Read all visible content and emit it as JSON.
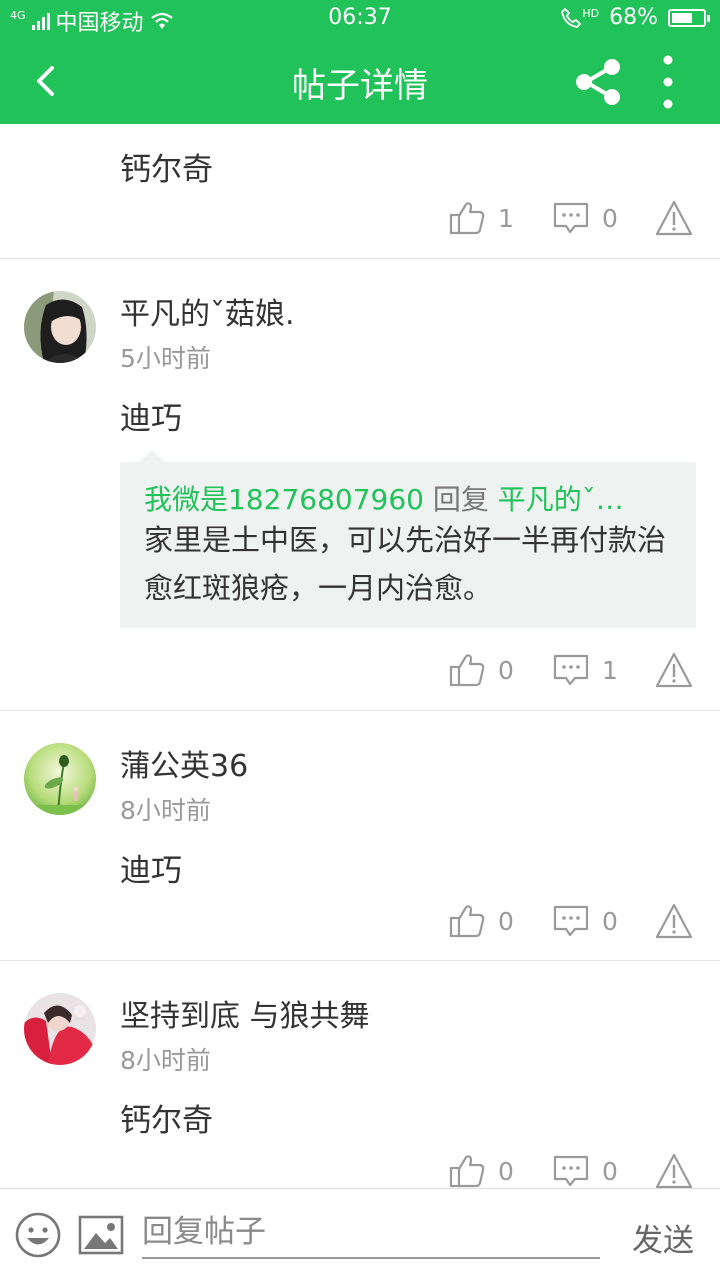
{
  "status_bar": {
    "network": "4G",
    "carrier": "中国移动",
    "time": "06:37",
    "call_icon": "phone-hd-icon",
    "hd_label": "HD",
    "battery_percent": "68%",
    "battery_level": 0.68
  },
  "header": {
    "title": "帖子详情",
    "back_icon": "chevron-left-icon",
    "share_icon": "share-icon",
    "more_icon": "more-vertical-icon",
    "color": "#22c25a"
  },
  "posts": [
    {
      "text": "钙尔奇",
      "likes": "1",
      "comments": "0"
    },
    {
      "username": "平凡的ˇ菇娘.",
      "time": "5小时前",
      "text": "迪巧",
      "reply": {
        "author": "我微是18276807960",
        "verb": "回复",
        "target": "平凡的ˇ…",
        "body": "家里是土中医，可以先治好一半再付款治愈红斑狼疮，一月内治愈。"
      },
      "likes": "0",
      "comments": "1"
    },
    {
      "username": "蒲公英36",
      "time": "8小时前",
      "text": "迪巧",
      "likes": "0",
      "comments": "0"
    },
    {
      "username": "坚持到底  与狼共舞",
      "time": "8小时前",
      "text": "钙尔奇",
      "likes": "0",
      "comments": "0"
    }
  ],
  "bottom_bar": {
    "emoji_icon": "emoji-icon",
    "image_icon": "image-icon",
    "input_placeholder": "回复帖子",
    "send_label": "发送"
  }
}
